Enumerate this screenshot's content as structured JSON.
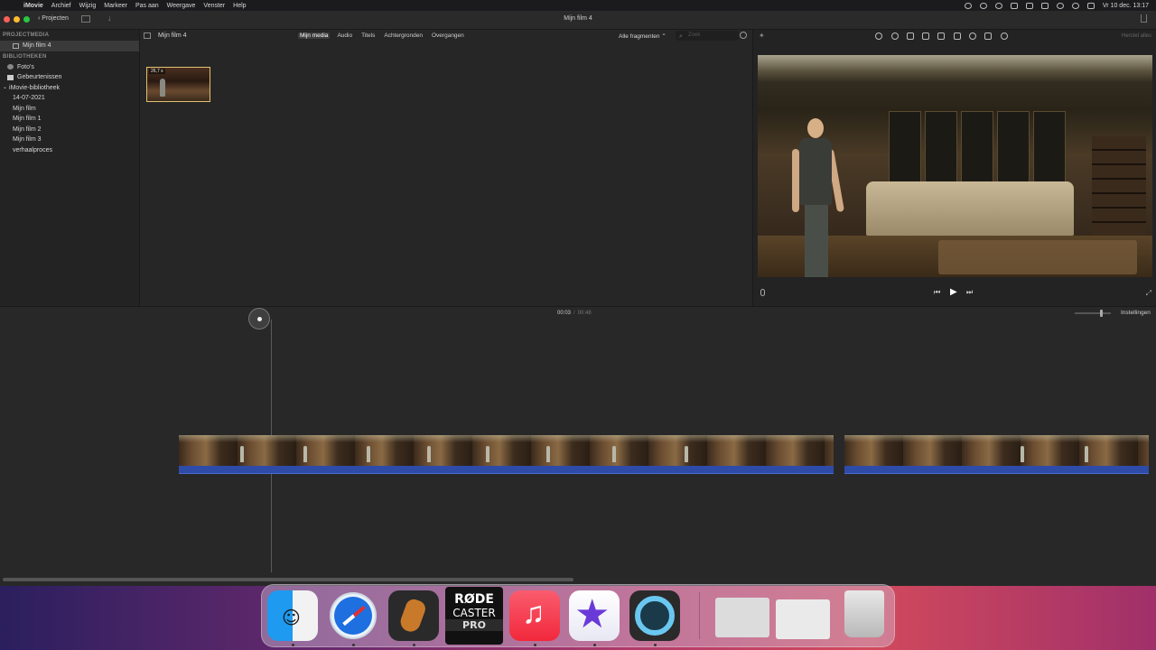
{
  "menubar": {
    "items": [
      "iMovie",
      "Archief",
      "Wijzig",
      "Markeer",
      "Pas aan",
      "Weergave",
      "Venster",
      "Help"
    ],
    "clock": "Vr 10 dec.  13:17"
  },
  "window": {
    "title": "Mijn film 4",
    "projects_button": "Projecten"
  },
  "sidebar": {
    "section_project": "PROJECTMEDIA",
    "project_item": "Mijn film 4",
    "section_libraries": "BIBLIOTHEKEN",
    "items": [
      {
        "label": "Foto's"
      },
      {
        "label": "Gebeurtenissen"
      },
      {
        "label": "iMovie-bibliotheek"
      },
      {
        "label": "14-07-2021"
      },
      {
        "label": "Mijn film"
      },
      {
        "label": "Mijn film 1"
      },
      {
        "label": "Mijn film 2"
      },
      {
        "label": "Mijn film 3"
      },
      {
        "label": "verhaalproces"
      }
    ]
  },
  "browser": {
    "title": "Mijn film 4",
    "tabs": [
      {
        "label": "Mijn media"
      },
      {
        "label": "Audio"
      },
      {
        "label": "Titels"
      },
      {
        "label": "Achtergronden"
      },
      {
        "label": "Overgangen"
      }
    ],
    "filter": "Alle fragmenten",
    "search_placeholder": "Zoek",
    "thumbnail_duration": "26,7 s"
  },
  "viewer": {
    "reset_all": "Herstel alles"
  },
  "timeline": {
    "current_time": "00:03",
    "separator": "/",
    "total_time": "00:48",
    "settings_label": "Instellingen"
  },
  "dock": {
    "rode_line1": "RØDE",
    "rode_line2": "CASTER",
    "rode_line3": "PRO"
  }
}
